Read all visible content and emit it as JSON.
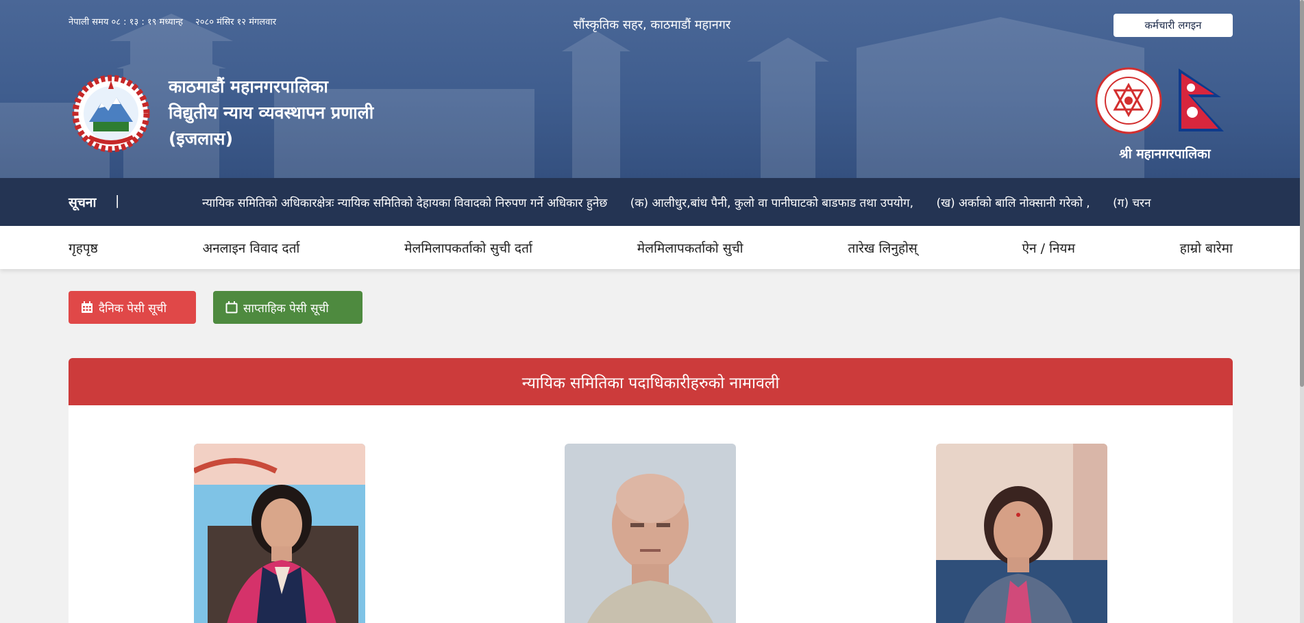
{
  "header": {
    "nepali_time": "नेपाली समय ०८ : १३ : १९ मध्यान्ह",
    "nepali_date": "२०८० मंसिर १२ मंगलवार",
    "tagline": "सौंस्कृतिक सहर, काठमाडौं महानगर",
    "login_label": "कर्मचारी लगइन",
    "title_line1": "काठमाडौं महानगरपालिका",
    "title_line2": "विद्युतीय न्याय व्यवस्थापन प्रणाली",
    "title_line3": "(इजलास)",
    "kmc_label": "श्री महानगरपालिका"
  },
  "notice": {
    "label": "सूचना",
    "separator": "|",
    "items": [
      "न्यायिक समितिको अधिकारक्षेत्रः न्यायिक समितिको देहायका विवादको निरुपण गर्ने अधिकार हुनेछ",
      "(क) आलीधुर,बांध पैनी, कुलो वा पानीघाटको बाडफाड तथा उपयोग,",
      "(ख) अर्काको बालि नोक्सानी गरेको ,",
      "(ग) चरन"
    ]
  },
  "nav": {
    "items": [
      "गृहपृष्ठ",
      "अनलाइन विवाद दर्ता",
      "मेलमिलापकर्ताको सुची दर्ता",
      "मेलमिलापकर्ताको सुची",
      "तारेख लिनुहोस्",
      "ऐन / नियम",
      "हाम्रो बारेमा"
    ]
  },
  "actions": {
    "daily_label": "दैनिक पेसी सूची",
    "weekly_label": "साप्ताहिक पेसी सूची"
  },
  "officials": {
    "title": "न्यायिक समितिका पदाधिकारीहरुको नामावली"
  },
  "colors": {
    "header_blue": "#4a6797",
    "notice_bar": "#243453",
    "daily_button": "#e04848",
    "weekly_button": "#4e8a3f",
    "card_header": "#cc3b3b"
  },
  "icons": {
    "daily": "calendar-grid-icon",
    "weekly": "calendar-outline-icon"
  }
}
